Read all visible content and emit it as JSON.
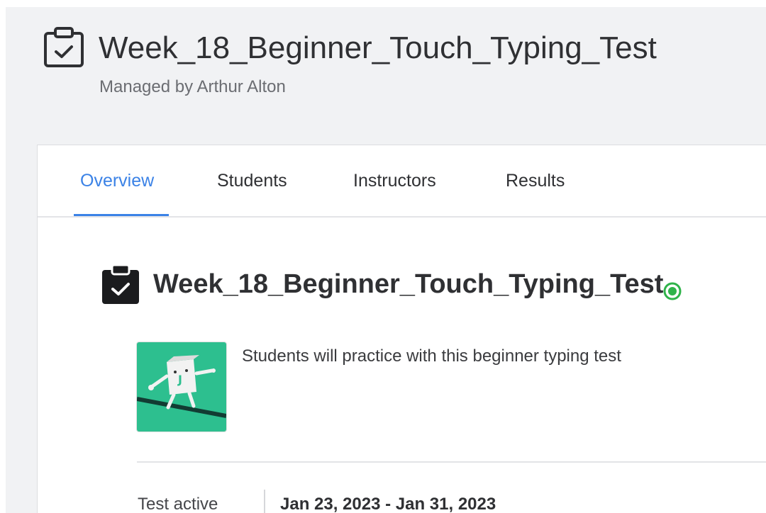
{
  "header": {
    "title": "Week_18_Beginner_Touch_Typing_Test",
    "subtitle": "Managed by Arthur Alton",
    "icon": "clipboard-check-outline-icon"
  },
  "tabs": [
    {
      "label": "Overview",
      "active": true
    },
    {
      "label": "Students",
      "active": false
    },
    {
      "label": "Instructors",
      "active": false
    },
    {
      "label": "Results",
      "active": false
    }
  ],
  "test": {
    "title": "Week_18_Beginner_Touch_Typing_Test",
    "icon": "clipboard-check-filled-icon",
    "status_icon": "active-status-dot-icon",
    "status_color": "#2fb34a",
    "description": "Students will practice with this beginner typing test",
    "thumbnail": "typing-mascot-thumbnail",
    "active_label": "Test active",
    "active_range": "Jan 23, 2023 - Jan 31, 2023"
  },
  "colors": {
    "accent": "#3b82e6",
    "thumbnail_bg": "#2dbf8f",
    "page_bg": "#f1f2f4"
  }
}
